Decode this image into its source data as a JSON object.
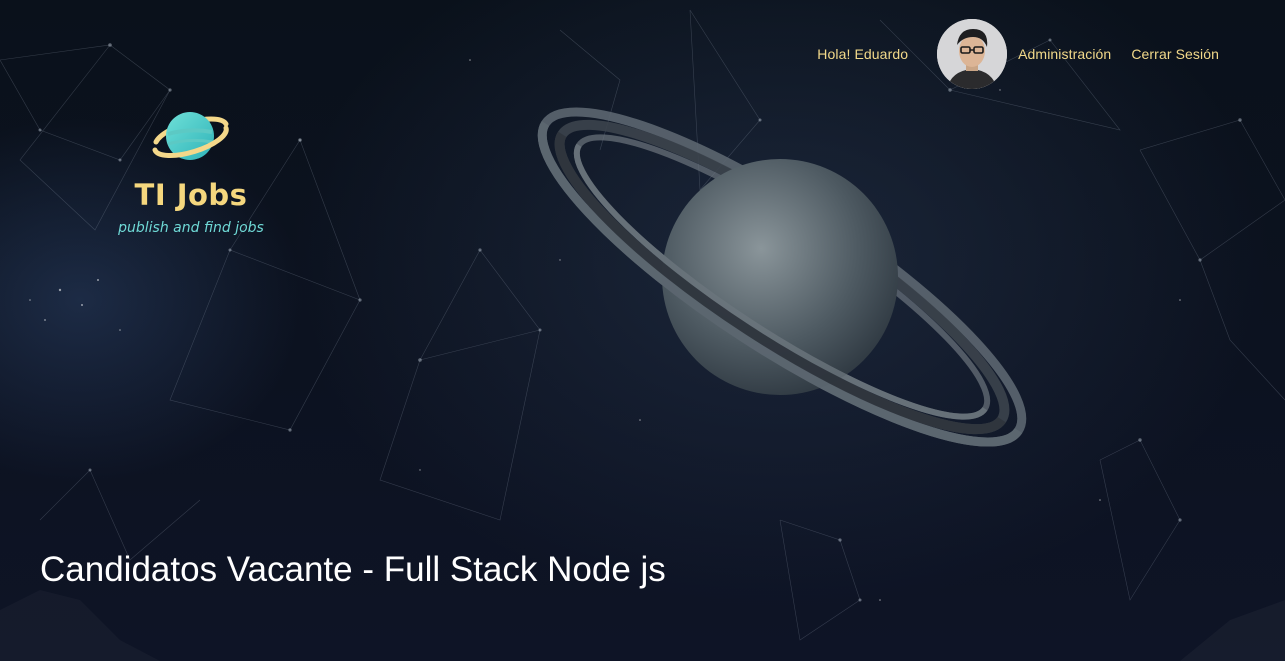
{
  "nav": {
    "greeting": "Hola! Eduardo",
    "admin_link": "Administración",
    "logout_link": "Cerrar Sesión",
    "text_color": "#f2d98a"
  },
  "logo": {
    "title": "TI Jobs",
    "tagline": "publish and find jobs",
    "icon": "planet-icon",
    "title_color": "#f5d77e",
    "tagline_color": "#6fd9d6"
  },
  "hero": {
    "title": "Candidatos Vacante - Full Stack Node js",
    "background": "space-with-saturn"
  }
}
